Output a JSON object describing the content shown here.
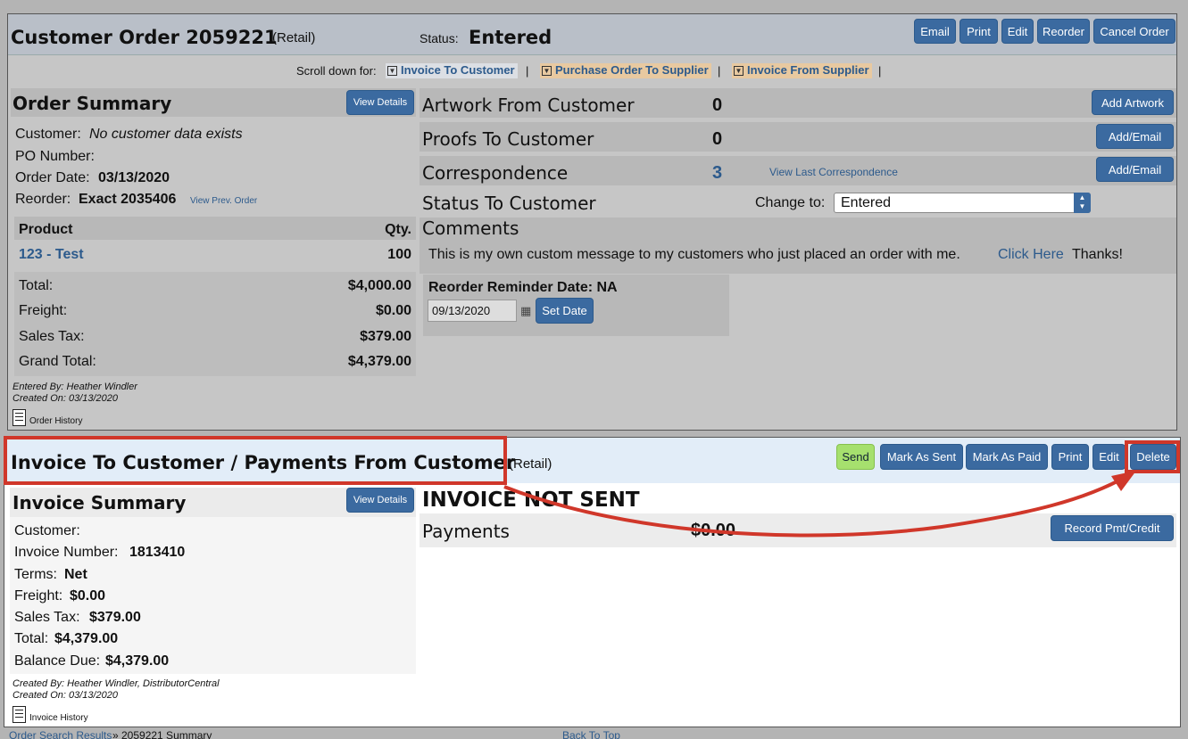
{
  "order": {
    "title": "Customer Order 2059221",
    "type": "(Retail)",
    "status_label": "Status:",
    "status_value": "Entered",
    "buttons": [
      "Email",
      "Print",
      "Edit",
      "Reorder",
      "Cancel Order"
    ],
    "scroll_label": "Scroll down for:",
    "jumps": [
      "Invoice To Customer",
      "Purchase Order To Supplier",
      "Invoice From Supplier"
    ],
    "summary": {
      "title": "Order Summary",
      "view_details": "View Details",
      "customer_label": "Customer:",
      "customer_value": "No customer data exists",
      "po_label": "PO Number:",
      "order_date_label": "Order Date:",
      "order_date": "03/13/2020",
      "reorder_label": "Reorder:",
      "reorder_value": "Exact 2035406",
      "view_prev": "View Prev. Order",
      "product_header": "Product",
      "qty_header": "Qty.",
      "product": "123 - Test",
      "qty": "100",
      "totals": [
        {
          "label": "Total:",
          "value": "$4,000.00"
        },
        {
          "label": "Freight:",
          "value": "$0.00"
        },
        {
          "label": "Sales Tax:",
          "value": "$379.00"
        },
        {
          "label": "Grand Total:",
          "value": "$4,379.00"
        }
      ],
      "entered_by": "Entered By: Heather Windler",
      "created_on": "Created On: 03/13/2020",
      "history": "Order History"
    },
    "artwork_label": "Artwork From Customer",
    "artwork_count": "0",
    "add_artwork": "Add Artwork",
    "proofs_label": "Proofs To Customer",
    "proofs_count": "0",
    "add_email": "Add/Email",
    "correspondence_label": "Correspondence",
    "correspondence_count": "3",
    "view_last": "View Last Correspondence",
    "status_to_customer": "Status To Customer",
    "change_to": "Change to:",
    "change_value": "Entered",
    "comments_label": "Comments",
    "comment_text": "This is my own custom message to my customers who just placed an order with me.",
    "comment_link": "Click Here",
    "comment_end": "Thanks!",
    "reminder_label": "Reorder Reminder Date: NA",
    "reminder_date": "09/13/2020",
    "set_date": "Set Date"
  },
  "invoice": {
    "title": "Invoice To Customer / Payments From Customer",
    "type": "(Retail)",
    "buttons": [
      "Send",
      "Mark As Sent",
      "Mark As Paid",
      "Print",
      "Edit",
      "Delete"
    ],
    "summary_title": "Invoice Summary",
    "view_details": "View Details",
    "customer_label": "Customer:",
    "invoice_number_label": "Invoice Number:",
    "invoice_number": "1813410",
    "terms_label": "Terms:",
    "terms": "Net",
    "freight_label": "Freight:",
    "freight": "$0.00",
    "tax_label": "Sales Tax:",
    "tax": "$379.00",
    "total_label": "Total:",
    "total": "$4,379.00",
    "balance_label": "Balance Due:",
    "balance": "$4,379.00",
    "created_by": "Created By: Heather Windler, DistributorCentral",
    "created_on": "Created On: 03/13/2020",
    "history": "Invoice History",
    "not_sent": "INVOICE NOT SENT",
    "payments_label": "Payments",
    "payments_value": "$0.00",
    "record_btn": "Record Pmt/Credit"
  },
  "footer": {
    "breadcrumb_link": "Order Search Results",
    "breadcrumb_rest": " » 2059221 Summary",
    "back_to_top": "Back To Top"
  },
  "colors": {
    "accent": "#3b6aa0",
    "highlight": "#d0372a",
    "send": "#a6e06e"
  }
}
